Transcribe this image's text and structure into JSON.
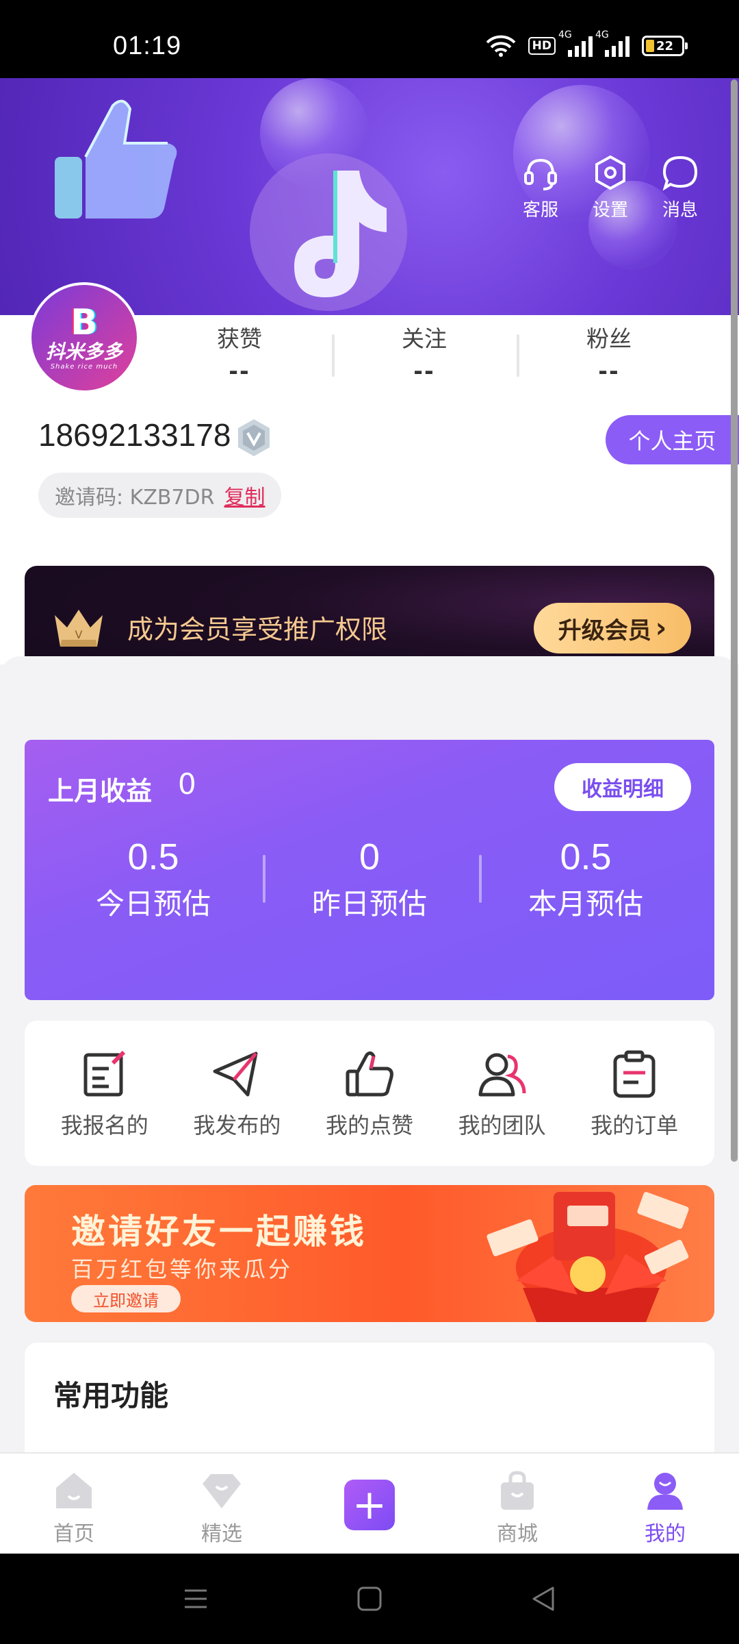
{
  "status_bar": {
    "time": "01:19",
    "hd_label": "HD",
    "network_1": "4G",
    "network_2": "4G",
    "battery": "22"
  },
  "header": {
    "actions": [
      {
        "label": "客服",
        "icon": "headset-icon"
      },
      {
        "label": "设置",
        "icon": "settings-hexagon-icon"
      },
      {
        "label": "消息",
        "icon": "message-bubble-icon"
      }
    ]
  },
  "profile": {
    "avatar_brand": "抖米多多",
    "avatar_letter": "B",
    "avatar_slogan": "Shake rice much",
    "stats": [
      {
        "label": "获赞",
        "value": "--"
      },
      {
        "label": "关注",
        "value": "--"
      },
      {
        "label": "粉丝",
        "value": "--"
      }
    ],
    "phone": "18692133178",
    "homepage_button": "个人主页",
    "invite_label": "邀请码: KZB7DR",
    "copy_label": "复制"
  },
  "member": {
    "text": "成为会员享受推广权限",
    "button": "升级会员",
    "button_chevron": "›"
  },
  "earnings": {
    "title": "上月收益",
    "title_value": "0",
    "detail_button": "收益明细",
    "items": [
      {
        "value": "0.5",
        "label": "今日预估"
      },
      {
        "value": "0",
        "label": "昨日预估"
      },
      {
        "value": "0.5",
        "label": "本月预估"
      }
    ]
  },
  "quick_links": [
    {
      "label": "我报名的",
      "icon": "signup-form-icon"
    },
    {
      "label": "我发布的",
      "icon": "paper-plane-icon"
    },
    {
      "label": "我的点赞",
      "icon": "thumbs-up-icon"
    },
    {
      "label": "我的团队",
      "icon": "team-people-icon"
    },
    {
      "label": "我的订单",
      "icon": "clipboard-icon"
    }
  ],
  "promo": {
    "title": "邀请好友一起赚钱",
    "subtitle": "百万红包等你来瓜分",
    "button": "立即邀请"
  },
  "common": {
    "title": "常用功能"
  },
  "tabbar": [
    {
      "label": "首页",
      "icon": "home-icon",
      "active": false
    },
    {
      "label": "精选",
      "icon": "featured-icon",
      "active": false
    },
    {
      "label": "",
      "icon": "plus-icon",
      "active": false
    },
    {
      "label": "商城",
      "icon": "shopping-bag-icon",
      "active": false
    },
    {
      "label": "我的",
      "icon": "profile-icon",
      "active": true
    }
  ],
  "colors": {
    "accent": "#8c5cf6",
    "active_tab": "#7c4cf2",
    "member_gold": "#f5c98f",
    "copy_red": "#e02d5b",
    "promo_orange": "#ff5a2a"
  }
}
